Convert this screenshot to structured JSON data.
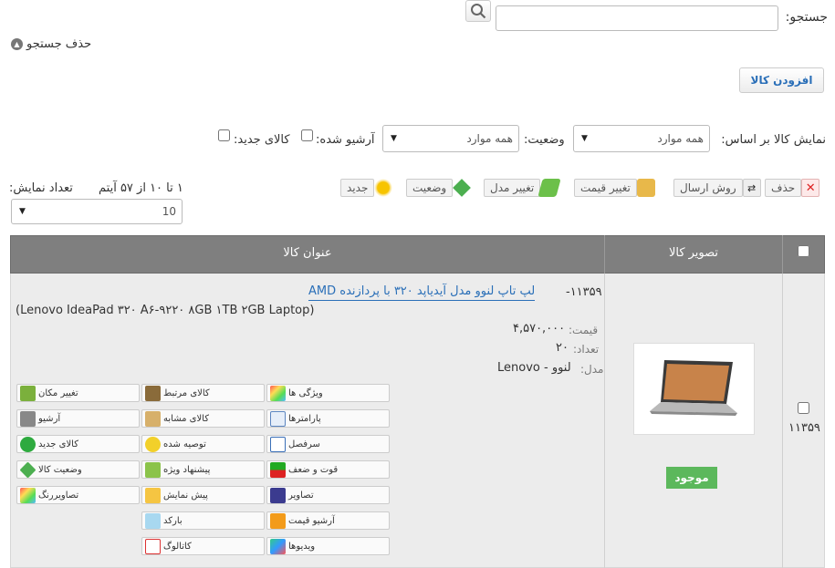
{
  "search": {
    "label": "جستجو:",
    "value": "",
    "clear_label": "حذف جستجو"
  },
  "add_product": {
    "label": "افزودن کالا"
  },
  "filters": {
    "show_by_label": "نمایش کالا بر اساس:",
    "show_by_value": "همه موارد",
    "status_label": "وضعیت:",
    "status_value": "همه موارد",
    "archived_label": "آرشیو شده:",
    "new_label": "کالای جدید:"
  },
  "toolbar": {
    "delete": "حذف",
    "shipping": "روش ارسال",
    "price": "تغییر قیمت",
    "model": "تغییر مدل",
    "status": "وضعیت",
    "new": "جدید"
  },
  "paging": {
    "summary": "۱ تا ۱۰ از ۵۷ آیتم",
    "per_page_label": "تعداد نمایش:",
    "per_page_value": "10"
  },
  "table": {
    "col_image": "تصویر کالا",
    "col_title": "عنوان کالا",
    "row": {
      "id": "۱۱۳۵۹",
      "id_prefix": "۱۱۳۵۹-",
      "title_link": "لپ تاپ لنوو مدل آیدیاپد ۳۲۰ با پردازنده AMD",
      "subtitle": "(Lenovo IdeaPad ۳۲۰ A۶-۹۲۲۰ ۸GB ۱TB ۲GB Laptop)",
      "price_label": "قیمت:",
      "price_value": "۴,۵۷۰,۰۰۰",
      "count_label": "تعداد:",
      "count_value": "۲۰",
      "model_label": "مدل:",
      "model_value": "لنوو - Lenovo",
      "stock_badge": "موجود"
    },
    "actions": {
      "c1": [
        "ویژگی ها",
        "پارامترها",
        "سرفصل",
        "قوت و ضعف",
        "تصاویر",
        "آرشیو قیمت",
        "ویدیوها"
      ],
      "c2": [
        "کالای مرتبط",
        "کالای مشابه",
        "توصیه شده",
        "پیشنهاد ویژه",
        "پیش نمایش",
        "بارکد",
        "کاتالوگ"
      ],
      "c3": [
        "تغییر مکان",
        "آرشیو",
        "کالای جدید",
        "وضعیت کالا",
        "تصاویررنگ"
      ]
    }
  },
  "colors": {
    "header_bg": "#7f7f7f",
    "link": "#2a6fb8",
    "badge": "#5cb85c"
  }
}
